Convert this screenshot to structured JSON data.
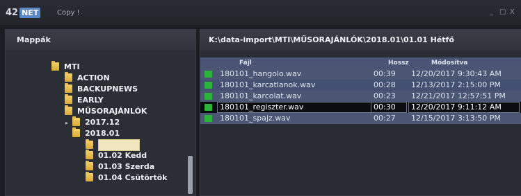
{
  "window": {
    "logo_text": "42",
    "logo_badge": "NET",
    "title": "Copy !",
    "minimize": "_",
    "maximize": "□",
    "close": "X"
  },
  "left_panel": {
    "header": "Mappák",
    "tree": [
      {
        "label": "MTI",
        "level": 0,
        "expander": ""
      },
      {
        "label": "ACTION",
        "level": 1,
        "expander": ""
      },
      {
        "label": "BACKUPNEWS",
        "level": 1,
        "expander": ""
      },
      {
        "label": "EARLY",
        "level": 1,
        "expander": ""
      },
      {
        "label": "MŰSORAJÁNLÓK",
        "level": 1,
        "expander": ""
      },
      {
        "label": "2017.12",
        "level": 2,
        "expander": "▸"
      },
      {
        "label": "2018.01",
        "level": 2,
        "expander": ""
      },
      {
        "label": "",
        "level": 3,
        "expander": "",
        "selected": true
      },
      {
        "label": "01.02 Kedd",
        "level": 3,
        "expander": ""
      },
      {
        "label": "01.03 Szerda",
        "level": 3,
        "expander": ""
      },
      {
        "label": "01.04 Csütörtök",
        "level": 3,
        "expander": ""
      }
    ]
  },
  "right_panel": {
    "path": "K:\\data-import\\MTI\\MŰSORAJÁNLÓK\\2018.01\\01.01 Hétfő",
    "columns": {
      "file": "Fájl",
      "duration": "Hossz",
      "modified": "Módosítva"
    },
    "files": [
      {
        "name": "180101_hangolo.wav",
        "duration": "00:39",
        "modified": "12/20/2017 9:30:43 AM"
      },
      {
        "name": "180101_karcatlanok.wav",
        "duration": "00:28",
        "modified": "12/13/2017 2:15:00 PM"
      },
      {
        "name": "180101_karcolat.wav",
        "duration": "00:23",
        "modified": "12/21/2017 12:57:51 PM"
      },
      {
        "name": "180101_regiszter.wav",
        "duration": "00:30",
        "modified": "12/20/2017 9:11:12 AM"
      },
      {
        "name": "180101_spajz.wav",
        "duration": "00:27",
        "modified": "12/15/2017 3:13:50 PM"
      }
    ],
    "selected_index": 3
  }
}
